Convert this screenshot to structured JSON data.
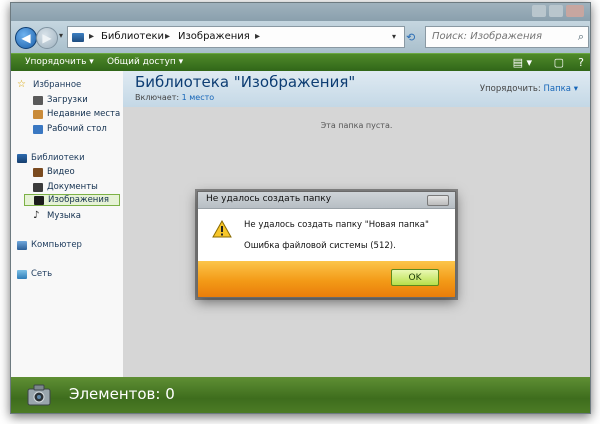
{
  "window": {
    "back_icon": "arrow-left-icon",
    "forward_icon": "arrow-right-icon"
  },
  "address": {
    "crumbs": [
      "Библиотеки",
      "Изображения"
    ],
    "separator": "▸",
    "refresh_icon": "refresh-icon"
  },
  "search": {
    "placeholder": "Поиск: Изображения",
    "icon": "search-icon"
  },
  "toolbar": {
    "arrange_label": "Упорядочить ▾",
    "share_label": "Общий доступ ▾",
    "accent": "#3f7a21"
  },
  "nav": {
    "favorites": "Избранное",
    "favorites_items": [
      "Загрузки",
      "Недавние места",
      "Рабочий стол"
    ],
    "libraries": "Библиотеки",
    "libraries_items": [
      "Видео",
      "Документы",
      "Изображения",
      "Музыка"
    ],
    "selected": "Изображения",
    "computer": "Компьютер",
    "network": "Сеть"
  },
  "library": {
    "title": "Библиотека \"Изображения\"",
    "includes_label": "Включает:",
    "includes_link": "1 место",
    "arrange_by_label": "Упорядочить:",
    "arrange_by_value": "Папка ▾",
    "empty_text": "Эта папка пуста."
  },
  "details": {
    "items_count": "Элементов: 0",
    "bar_color": "#4c7b25"
  },
  "dialog": {
    "title": "Не удалось создать папку",
    "message": "Не удалось создать папку \"Новая папка\"",
    "error": "Ошибка файловой системы (512).",
    "ok_label": "OK",
    "icon": "warning-icon",
    "footer_color": "#f39a17"
  }
}
